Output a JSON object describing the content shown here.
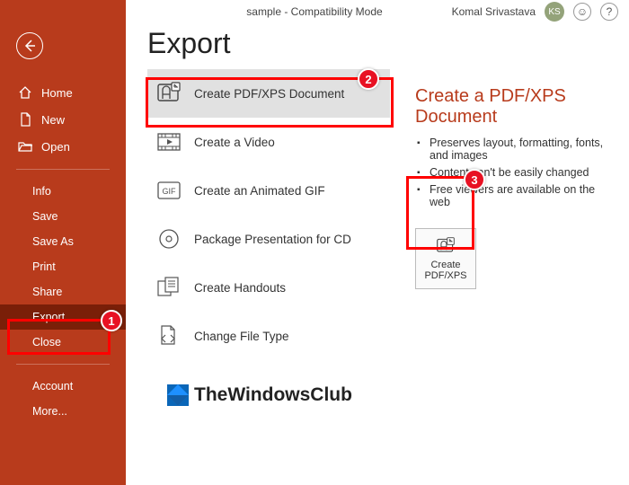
{
  "header": {
    "title": "sample  -  Compatibility Mode",
    "user_name": "Komal Srivastava",
    "user_initials": "KS"
  },
  "sidebar": {
    "items": [
      {
        "label": "Home"
      },
      {
        "label": "New"
      },
      {
        "label": "Open"
      }
    ],
    "subitems": [
      {
        "label": "Info"
      },
      {
        "label": "Save"
      },
      {
        "label": "Save As"
      },
      {
        "label": "Print"
      },
      {
        "label": "Share"
      },
      {
        "label": "Export",
        "selected": true
      },
      {
        "label": "Close"
      }
    ],
    "footer": [
      {
        "label": "Account"
      },
      {
        "label": "More..."
      }
    ]
  },
  "main": {
    "title": "Export",
    "options": [
      {
        "label": "Create PDF/XPS Document",
        "selected": true
      },
      {
        "label": "Create a Video"
      },
      {
        "label": "Create an Animated GIF"
      },
      {
        "label": "Package Presentation for CD"
      },
      {
        "label": "Create Handouts"
      },
      {
        "label": "Change File Type"
      }
    ],
    "detail": {
      "title": "Create a PDF/XPS Document",
      "bullets": [
        "Preserves layout, formatting, fonts, and images",
        "Content can't be easily changed",
        "Free viewers are available on the web"
      ],
      "action_label": "Create PDF/XPS"
    }
  },
  "watermark": {
    "text": "TheWindowsClub"
  },
  "annotations": {
    "callouts": {
      "c1": "1",
      "c2": "2",
      "c3": "3"
    }
  }
}
